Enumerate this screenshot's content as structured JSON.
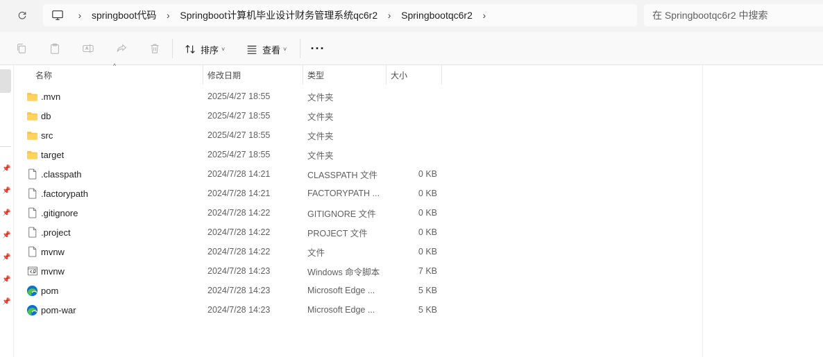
{
  "breadcrumbs": [
    "springboot代码",
    "Springboot计算机毕业设计财务管理系统qc6r2",
    "Springbootqc6r2"
  ],
  "search": {
    "placeholder": "在 Springbootqc6r2 中搜索"
  },
  "toolbar": {
    "sort_label": "排序",
    "view_label": "查看",
    "more_label": "···"
  },
  "columns": {
    "name": "名称",
    "date": "修改日期",
    "type": "类型",
    "size": "大小"
  },
  "files": [
    {
      "name": ".mvn",
      "date": "2025/4/27 18:55",
      "type": "文件夹",
      "size": "",
      "icon": "folder-icon"
    },
    {
      "name": "db",
      "date": "2025/4/27 18:55",
      "type": "文件夹",
      "size": "",
      "icon": "folder-icon"
    },
    {
      "name": "src",
      "date": "2025/4/27 18:55",
      "type": "文件夹",
      "size": "",
      "icon": "folder-icon"
    },
    {
      "name": "target",
      "date": "2025/4/27 18:55",
      "type": "文件夹",
      "size": "",
      "icon": "folder-icon"
    },
    {
      "name": ".classpath",
      "date": "2024/7/28 14:21",
      "type": "CLASSPATH 文件",
      "size": "0 KB",
      "icon": "file-icon"
    },
    {
      "name": ".factorypath",
      "date": "2024/7/28 14:21",
      "type": "FACTORYPATH ...",
      "size": "0 KB",
      "icon": "file-icon"
    },
    {
      "name": ".gitignore",
      "date": "2024/7/28 14:22",
      "type": "GITIGNORE 文件",
      "size": "0 KB",
      "icon": "file-icon"
    },
    {
      "name": ".project",
      "date": "2024/7/28 14:22",
      "type": "PROJECT 文件",
      "size": "0 KB",
      "icon": "file-icon"
    },
    {
      "name": "mvnw",
      "date": "2024/7/28 14:22",
      "type": "文件",
      "size": "0 KB",
      "icon": "file-icon"
    },
    {
      "name": "mvnw",
      "date": "2024/7/28 14:23",
      "type": "Windows 命令脚本",
      "size": "7 KB",
      "icon": "script-icon"
    },
    {
      "name": "pom",
      "date": "2024/7/28 14:23",
      "type": "Microsoft Edge ...",
      "size": "5 KB",
      "icon": "edge-icon"
    },
    {
      "name": "pom-war",
      "date": "2024/7/28 14:23",
      "type": "Microsoft Edge ...",
      "size": "5 KB",
      "icon": "edge-icon"
    }
  ],
  "colors": {
    "folder": "#f8c64b",
    "edge_blue": "#0c6fd1",
    "edge_green": "#4fc34d"
  }
}
